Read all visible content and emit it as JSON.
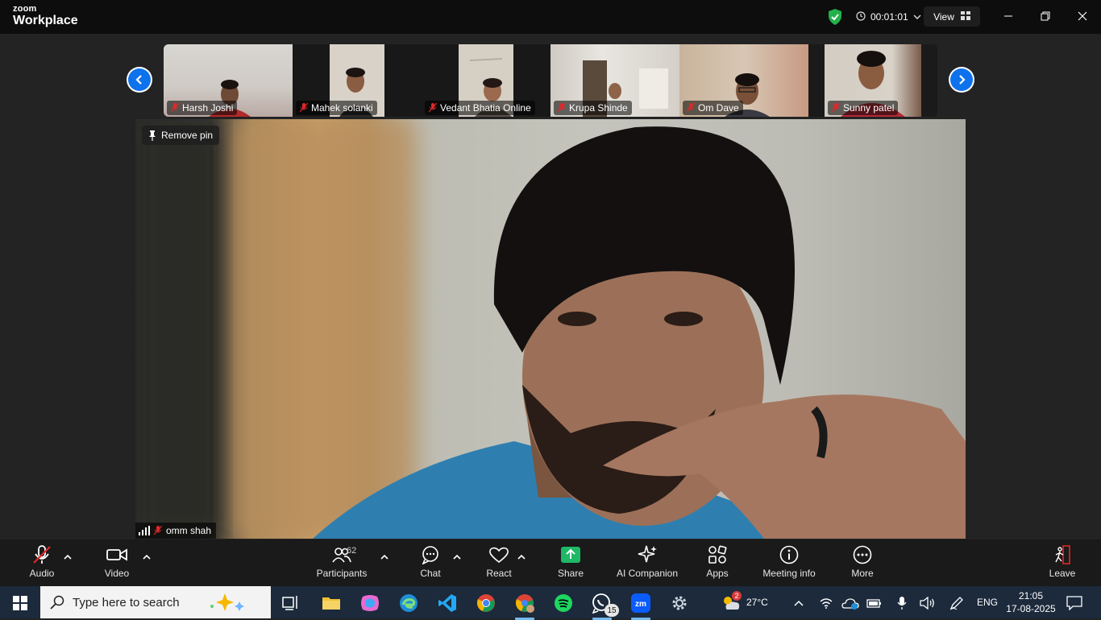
{
  "app": {
    "logo_top": "zoom",
    "logo_bottom": "Workplace"
  },
  "titlebar": {
    "timer": "00:01:01",
    "view_label": "View"
  },
  "gallery": {
    "participants": [
      {
        "name": "Harsh Joshi"
      },
      {
        "name": "Mahek solanki"
      },
      {
        "name": "Vedant Bhatia Online"
      },
      {
        "name": "Krupa Shinde"
      },
      {
        "name": "Om Dave"
      },
      {
        "name": "Sunny patel"
      }
    ]
  },
  "main_video": {
    "pin_label": "Remove pin",
    "speaker_name": "omm shah"
  },
  "toolbar": {
    "audio": "Audio",
    "video": "Video",
    "participants": "Participants",
    "participant_count": "62",
    "chat": "Chat",
    "react": "React",
    "share": "Share",
    "ai_companion": "AI Companion",
    "apps": "Apps",
    "meeting_info": "Meeting info",
    "more": "More",
    "leave": "Leave"
  },
  "taskbar": {
    "search_placeholder": "Type here to search",
    "whatsapp_badge": "15",
    "weather_badge": "2",
    "temperature": "27°C",
    "language": "ENG",
    "time": "21:05",
    "date": "17-08-2025"
  },
  "colors": {
    "accent": "#0e72ed",
    "share_green": "#1fb866",
    "mute_red": "#e02828",
    "security_green": "#22b14c"
  }
}
